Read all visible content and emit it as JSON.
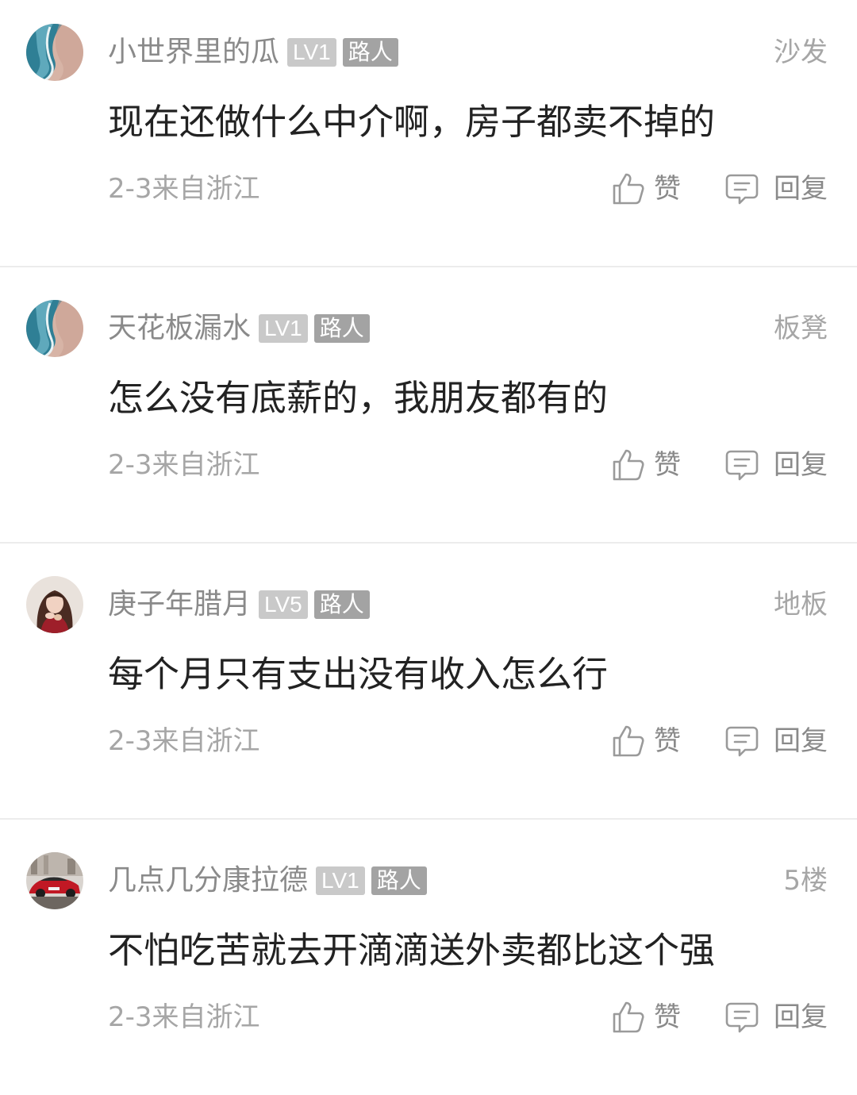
{
  "comments": [
    {
      "username": "小世界里的瓜",
      "level": "LV1",
      "role": "路人",
      "floor": "沙发",
      "content": "现在还做什么中介啊，房子都卖不掉的",
      "meta": "2-3来自浙江",
      "like_label": "赞",
      "reply_label": "回复",
      "avatar": "beach-wave-avatar"
    },
    {
      "username": "天花板漏水",
      "level": "LV1",
      "role": "路人",
      "floor": "板凳",
      "content": "怎么没有底薪的，我朋友都有的",
      "meta": "2-3来自浙江",
      "like_label": "赞",
      "reply_label": "回复",
      "avatar": "beach-wave-avatar"
    },
    {
      "username": "庚子年腊月",
      "level": "LV5",
      "role": "路人",
      "floor": "地板",
      "content": "每个月只有支出没有收入怎么行",
      "meta": "2-3来自浙江",
      "like_label": "赞",
      "reply_label": "回复",
      "avatar": "person-avatar"
    },
    {
      "username": "几点几分康拉德",
      "level": "LV1",
      "role": "路人",
      "floor": "5楼",
      "content": "不怕吃苦就去开滴滴送外卖都比这个强",
      "meta": "2-3来自浙江",
      "like_label": "赞",
      "reply_label": "回复",
      "avatar": "red-car-avatar"
    }
  ],
  "colors": {
    "username": "#8a8a8a",
    "content": "#222222",
    "meta": "#a6a6a6",
    "badge_level": "#c9c9c9",
    "badge_role": "#a3a3a3",
    "divider": "#ececec"
  }
}
